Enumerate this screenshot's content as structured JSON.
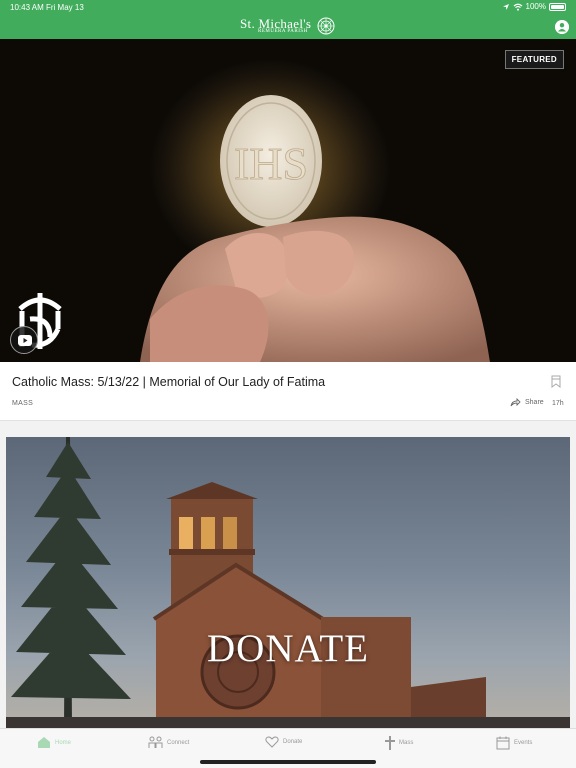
{
  "status_bar": {
    "time": "10:43 AM",
    "date": "Fri May 13",
    "battery": "100%"
  },
  "header": {
    "brand_name": "St. Michael's",
    "brand_sub": "REMUERA PARISH"
  },
  "featured_card": {
    "badge": "FEATURED",
    "title": "Catholic Mass: 5/13/22 | Memorial of Our Lady of Fatima",
    "category": "MASS",
    "share_label": "Share",
    "time_ago": "17h"
  },
  "donate_card": {
    "label": "DONATE"
  },
  "tabbar": {
    "items": [
      {
        "label": "Home",
        "icon": "home-icon"
      },
      {
        "label": "Connect",
        "icon": "people-icon"
      },
      {
        "label": "Donate",
        "icon": "heart-icon"
      },
      {
        "label": "Mass",
        "icon": "cross-icon"
      },
      {
        "label": "Events",
        "icon": "calendar-icon"
      }
    ]
  },
  "colors": {
    "header_green": "#41ad5c",
    "tab_active": "#a8d8b4",
    "tab_inactive": "#999999"
  }
}
